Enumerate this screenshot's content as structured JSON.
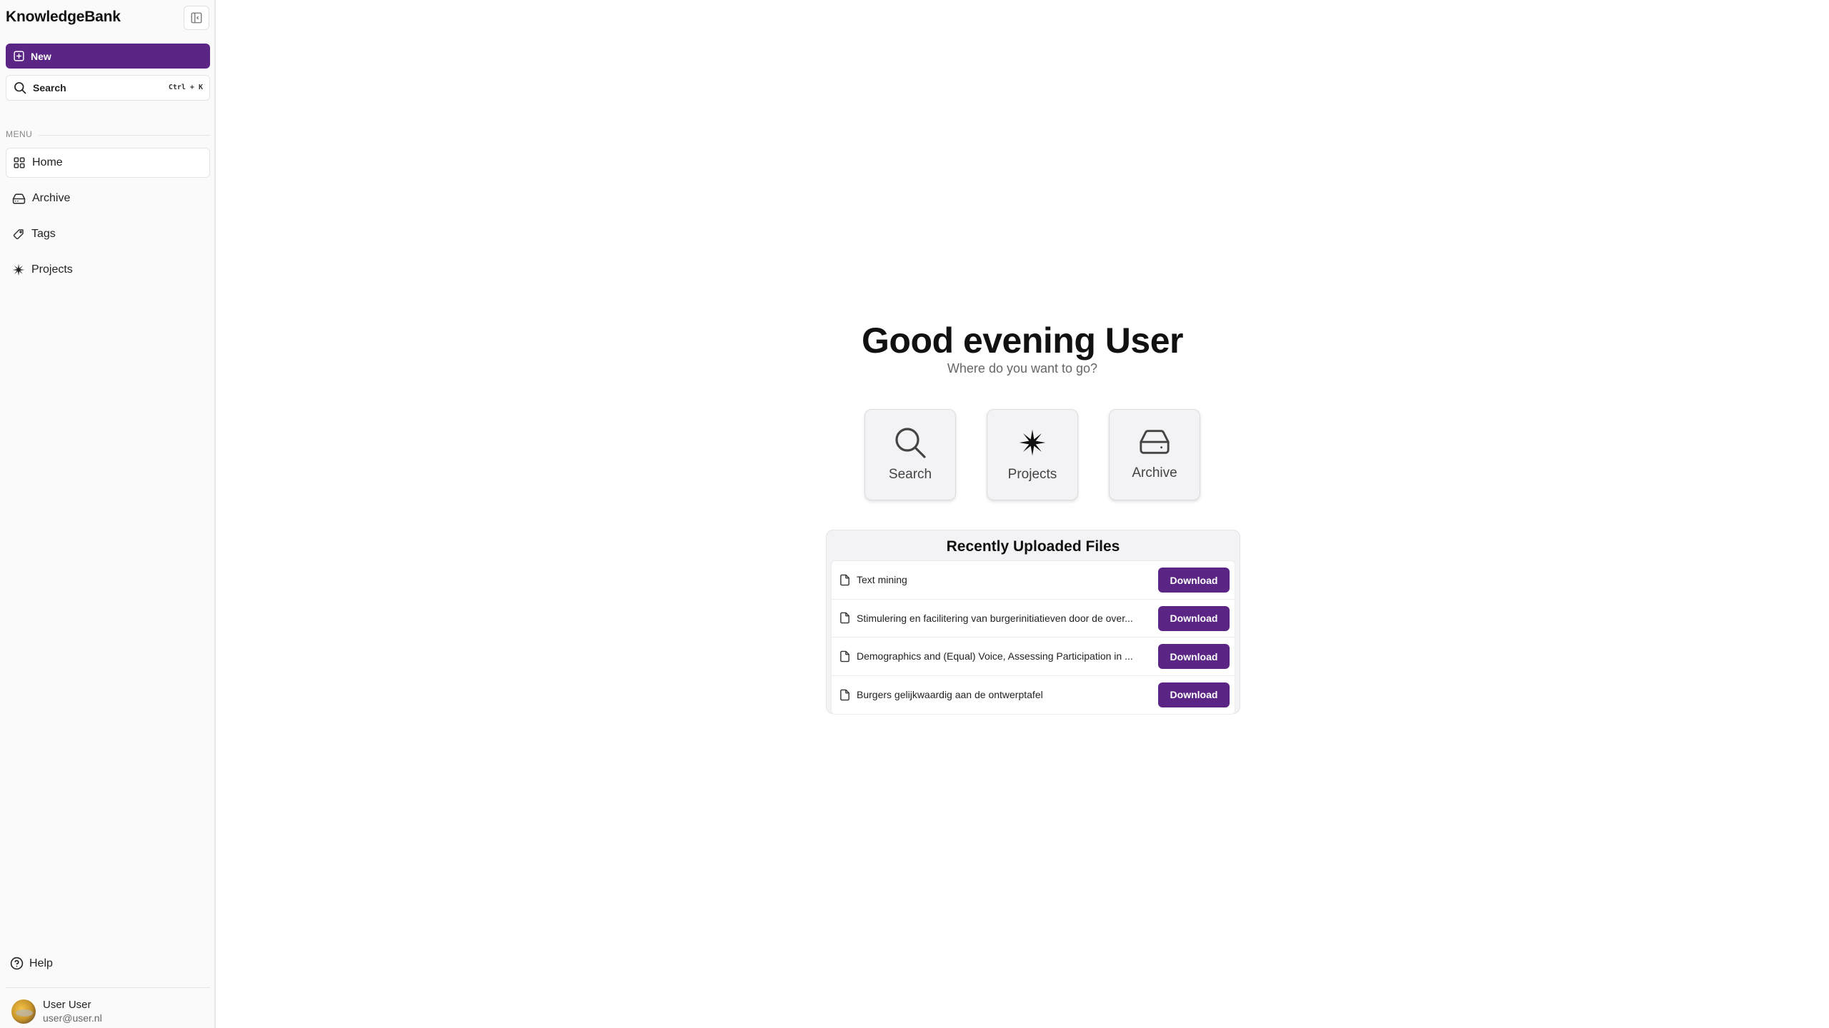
{
  "app": {
    "title": "KnowledgeBank"
  },
  "sidebar": {
    "new_label": "New",
    "search_label": "Search",
    "search_shortcut": "Ctrl + K",
    "menu_label": "MENU",
    "items": [
      {
        "label": "Home",
        "icon": "grid-icon",
        "active": true
      },
      {
        "label": "Archive",
        "icon": "hard-drive-icon",
        "active": false
      },
      {
        "label": "Tags",
        "icon": "tag-icon",
        "active": false
      },
      {
        "label": "Projects",
        "icon": "sparkle-icon",
        "active": false
      }
    ],
    "help_label": "Help",
    "user": {
      "name": "User User",
      "email": "user@user.nl"
    }
  },
  "main": {
    "greeting": "Good evening User",
    "subtitle": "Where do you want to go?",
    "tiles": [
      {
        "label": "Search",
        "icon": "search-icon"
      },
      {
        "label": "Projects",
        "icon": "sparkle-icon"
      },
      {
        "label": "Archive",
        "icon": "hard-drive-icon"
      }
    ],
    "recent": {
      "title": "Recently Uploaded Files",
      "download_label": "Download",
      "files": [
        "Text mining",
        "Stimulering en facilitering van burgerinitiatieven door de over...",
        "Demographics and (Equal) Voice, Assessing Participation in ...",
        "Burgers gelijkwaardig aan de ontwerptafel"
      ]
    }
  },
  "colors": {
    "accent": "#5b2585",
    "sidebar_bg": "#fafafa"
  }
}
